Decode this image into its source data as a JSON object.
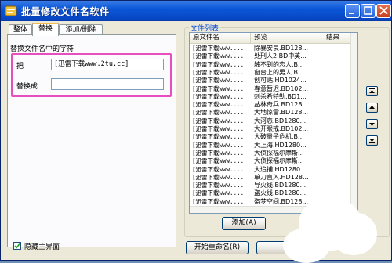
{
  "window": {
    "title": "批量修改文件名软件"
  },
  "tabs": [
    {
      "label": "整体"
    },
    {
      "label": "替换"
    },
    {
      "label": "添加/删除"
    }
  ],
  "replace_panel": {
    "group_label": "替换文件名中的字符",
    "find_label": "把",
    "find_value": "[迅雷下载www.2tu.cc]",
    "replace_label": "替换成",
    "replace_value": ""
  },
  "file_list": {
    "group_label": "文件列表",
    "columns": [
      "原文件名",
      "预览",
      "结果"
    ],
    "rows": [
      {
        "original": "[迅雷下载www....",
        "preview": "除暴安良.BD128...",
        "result": ""
      },
      {
        "original": "[迅雷下载www....",
        "preview": "处刑人2.BD中英...",
        "result": ""
      },
      {
        "original": "[迅雷下载www....",
        "preview": "触不到的恋人.B...",
        "result": ""
      },
      {
        "original": "[迅雷下载www....",
        "preview": "窗台上的男人.B...",
        "result": ""
      },
      {
        "original": "[迅雷下载www....",
        "preview": "创可贴.HD1024...",
        "result": ""
      },
      {
        "original": "[迅雷下载www....",
        "preview": "春意暂迟.BD102...",
        "result": ""
      },
      {
        "original": "[迅雷下载www....",
        "preview": "刺杀希特勒.BD1...",
        "result": ""
      },
      {
        "original": "[迅雷下载www....",
        "preview": "丛林奇兵.BD128...",
        "result": ""
      },
      {
        "original": "[迅雷下载www....",
        "preview": "大地惊雷.BD128...",
        "result": ""
      },
      {
        "original": "[迅雷下载www....",
        "preview": "大河恋.BD1280...",
        "result": ""
      },
      {
        "original": "[迅雷下载www....",
        "preview": "大开眼戒.BD102...",
        "result": ""
      },
      {
        "original": "[迅雷下载www....",
        "preview": "大破量子危机.B...",
        "result": ""
      },
      {
        "original": "[迅雷下载www....",
        "preview": "大上海.HD1280...",
        "result": ""
      },
      {
        "original": "[迅雷下载www....",
        "preview": "大侦探福尔摩斯...",
        "result": ""
      },
      {
        "original": "[迅雷下载www....",
        "preview": "大侦探福尔摩斯...",
        "result": ""
      },
      {
        "original": "[迅雷下载www....",
        "preview": "大追捕.HD1280...",
        "result": ""
      },
      {
        "original": "[迅雷下载www....",
        "preview": "单刀直入.HD128...",
        "result": ""
      },
      {
        "original": "[迅雷下载www....",
        "preview": "导火线.BD1280...",
        "result": ""
      },
      {
        "original": "[迅雷下载www....",
        "preview": "盗火线.BD1280...",
        "result": ""
      },
      {
        "original": "[迅雷下载www....",
        "preview": "盗梦空间.BD128...",
        "result": ""
      }
    ],
    "add_button": "添加(A)"
  },
  "footer": {
    "hide_main_label": "隐藏主界面",
    "hide_main_checked": true,
    "start_rename_button": "开始重命名(R)"
  },
  "colors": {
    "titlebar": "#0a57d8",
    "highlight": "#e74fbf",
    "group_title": "#0046d5"
  }
}
